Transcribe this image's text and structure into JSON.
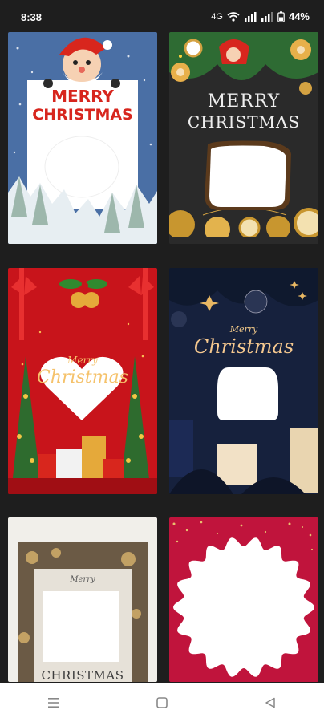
{
  "status": {
    "time": "8:38",
    "battery": "44%",
    "network_label": "4G"
  },
  "cards": [
    {
      "line1": "MERRY",
      "line2": "CHRISTMAS"
    },
    {
      "line1": "MERRY",
      "line2": "CHRISTMAS"
    },
    {
      "line1": "Merry",
      "line2": "Christmas"
    },
    {
      "line1": "Merry",
      "line2": "Christmas"
    },
    {
      "line1": "Merry",
      "line2": "CHRISTMAS"
    },
    {
      "line1": "",
      "line2": ""
    }
  ],
  "colors": {
    "background": "#1e1e1e",
    "card1_bg": "#4a6fa5",
    "card1_text": "#d7261e",
    "card2_bg": "#2a2a2a",
    "card3_bg": "#c8141b",
    "card4_bg": "#16213d",
    "card5_bg": "#f1efea",
    "card6_bg": "#c0143c"
  },
  "icons": {
    "nav_recent": "menu-lines-icon",
    "nav_home": "square-icon",
    "nav_back": "triangle-back-icon",
    "wifi": "wifi-icon",
    "signal": "signal-icon",
    "battery": "battery-icon"
  }
}
